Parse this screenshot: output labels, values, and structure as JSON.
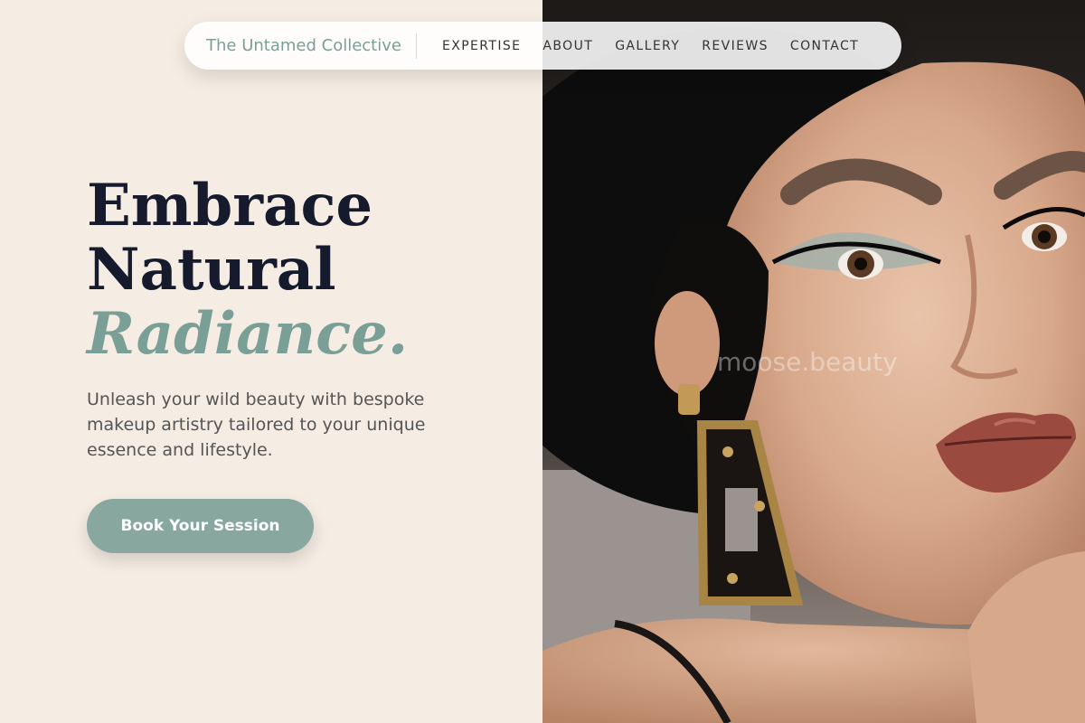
{
  "nav": {
    "brand": "The Untamed Collective",
    "links": [
      "EXPERTISE",
      "ABOUT",
      "GALLERY",
      "REVIEWS",
      "CONTACT"
    ]
  },
  "hero": {
    "title_line1": "Embrace",
    "title_line2": "Natural",
    "title_accent": "Radiance.",
    "subtitle": "Unleash your wild beauty with bespoke makeup artistry tailored to your unique essence and lifestyle.",
    "cta": "Book Your Session"
  },
  "image": {
    "watermark": "moose.beauty",
    "subject": "portrait-woman-makeup"
  },
  "colors": {
    "background": "#f5ece3",
    "accent": "#88a79e",
    "brand_text": "#7a9f96",
    "heading": "#151a2c",
    "body_text": "#555555"
  }
}
